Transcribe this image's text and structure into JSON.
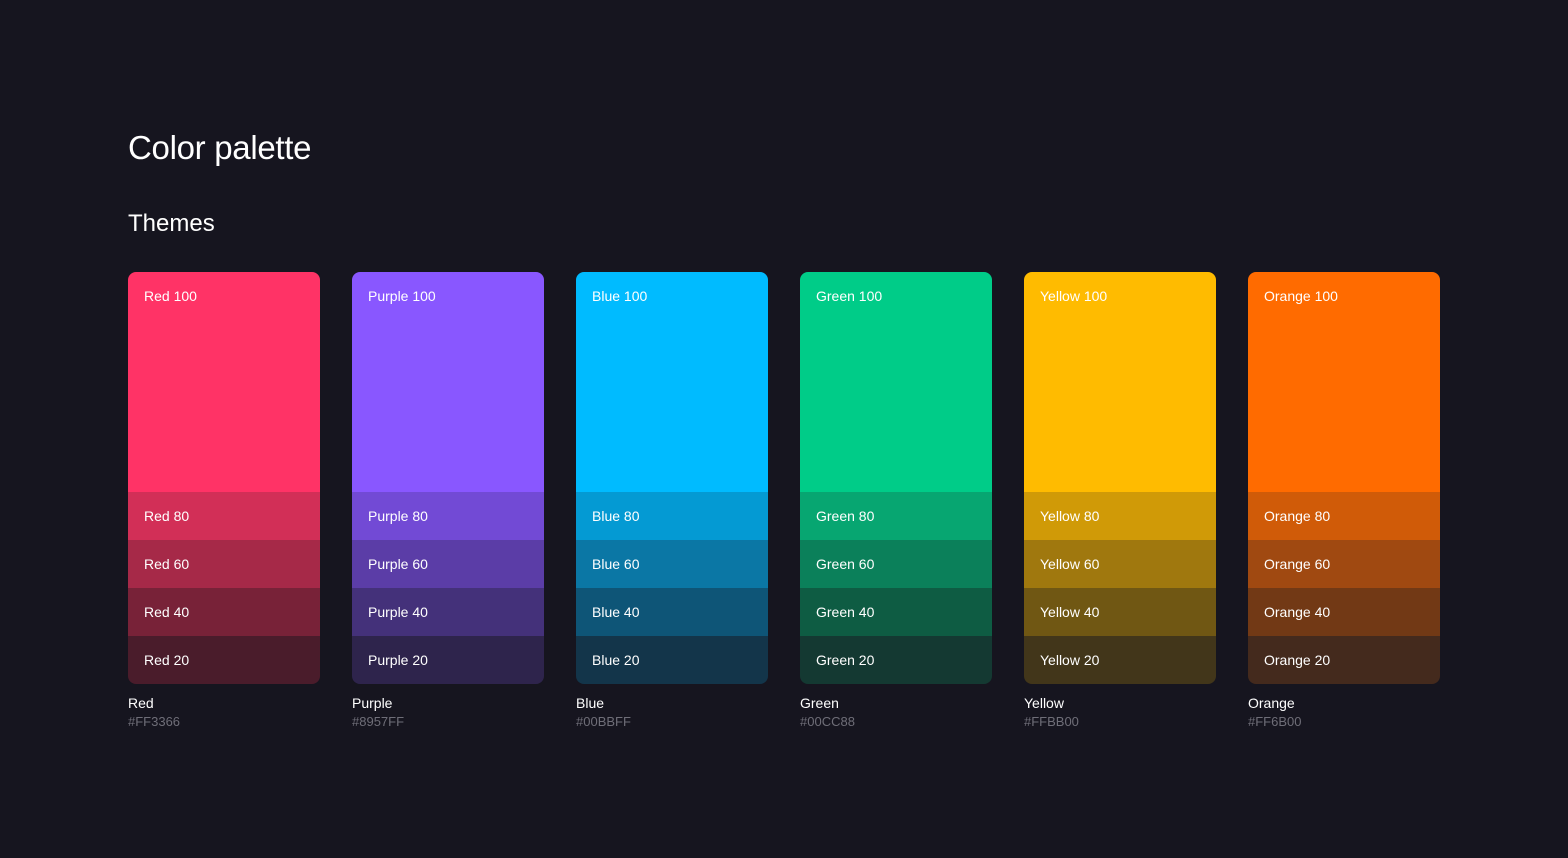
{
  "header": {
    "title": "Color palette",
    "section": "Themes"
  },
  "themes": [
    {
      "name": "Red",
      "hex": "#FF3366",
      "shades": [
        {
          "label": "Red 100",
          "color": "#FF3366"
        },
        {
          "label": "Red 80",
          "color": "#D22F57"
        },
        {
          "label": "Red 60",
          "color": "#A62948"
        },
        {
          "label": "Red 40",
          "color": "#782238"
        },
        {
          "label": "Red 20",
          "color": "#4A1C2B"
        }
      ]
    },
    {
      "name": "Purple",
      "hex": "#8957FF",
      "shades": [
        {
          "label": "Purple 100",
          "color": "#8957FF"
        },
        {
          "label": "Purple 80",
          "color": "#724AD5"
        },
        {
          "label": "Purple 60",
          "color": "#5B3DA7"
        },
        {
          "label": "Purple 40",
          "color": "#44317A"
        },
        {
          "label": "Purple 20",
          "color": "#2E244C"
        }
      ]
    },
    {
      "name": "Blue",
      "hex": "#00BBFF",
      "shades": [
        {
          "label": "Blue 100",
          "color": "#00BBFF"
        },
        {
          "label": "Blue 80",
          "color": "#049AD3"
        },
        {
          "label": "Blue 60",
          "color": "#0B77A5"
        },
        {
          "label": "Blue 40",
          "color": "#0E5577"
        },
        {
          "label": "Blue 20",
          "color": "#13354A"
        }
      ]
    },
    {
      "name": "Green",
      "hex": "#00CC88",
      "shades": [
        {
          "label": "Green 100",
          "color": "#00CC88"
        },
        {
          "label": "Green 80",
          "color": "#07A671"
        },
        {
          "label": "Green 60",
          "color": "#0B805A"
        },
        {
          "label": "Green 40",
          "color": "#0E5C43"
        },
        {
          "label": "Green 20",
          "color": "#143932"
        }
      ]
    },
    {
      "name": "Yellow",
      "hex": "#FFBB00",
      "shades": [
        {
          "label": "Yellow 100",
          "color": "#FFBB00"
        },
        {
          "label": "Yellow 80",
          "color": "#D09A07"
        },
        {
          "label": "Yellow 60",
          "color": "#A0780E"
        },
        {
          "label": "Yellow 40",
          "color": "#705713"
        },
        {
          "label": "Yellow 20",
          "color": "#42361A"
        }
      ]
    },
    {
      "name": "Orange",
      "hex": "#FF6B00",
      "shades": [
        {
          "label": "Orange 100",
          "color": "#FF6B00"
        },
        {
          "label": "Orange 80",
          "color": "#D05B08"
        },
        {
          "label": "Orange 60",
          "color": "#A04911"
        },
        {
          "label": "Orange 40",
          "color": "#723915"
        },
        {
          "label": "Orange 20",
          "color": "#442A1D"
        }
      ]
    }
  ]
}
